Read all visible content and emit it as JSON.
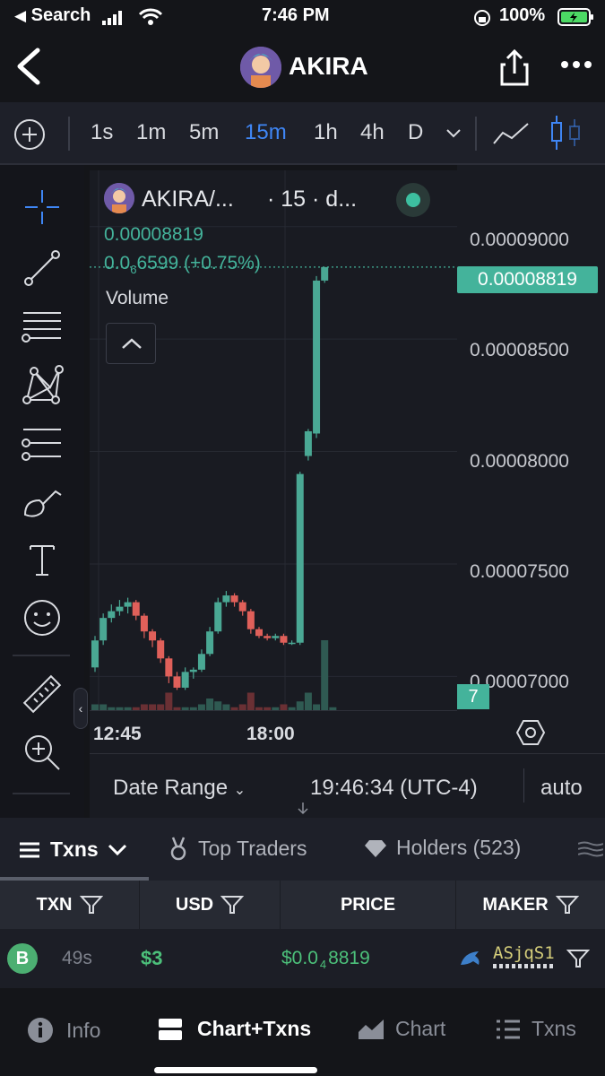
{
  "status": {
    "back_label": "Search",
    "time": "7:46 PM",
    "battery": "100%"
  },
  "nav": {
    "title": "AKIRA"
  },
  "toolbar": {
    "timeframes": [
      "1s",
      "1m",
      "5m",
      "15m",
      "1h",
      "4h",
      "D"
    ],
    "active_timeframe": "15m"
  },
  "legend": {
    "pair": "AKIRA/...",
    "interval": "· 15 · d...",
    "price": "0.00008819",
    "change_prefix": "0.0",
    "change_sub": "6",
    "change_rest": "6599 (+0.75%)",
    "volume_label": "Volume"
  },
  "yaxis": {
    "labels": [
      "0.00009000",
      "0.00008500",
      "0.00008000",
      "0.00007500",
      "0.00007000"
    ],
    "current_price": "0.00008819",
    "volume_badge": "7"
  },
  "xaxis": {
    "labels": [
      "12:45",
      "18:00"
    ]
  },
  "range": {
    "date_range": "Date Range",
    "clock": "19:46:34 (UTC-4)",
    "scale": "auto"
  },
  "tabs": {
    "txns": "Txns",
    "top_traders": "Top Traders",
    "holders": "Holders (523)"
  },
  "table": {
    "headers": [
      "TXN",
      "USD",
      "PRICE",
      "MAKER"
    ],
    "row": {
      "type": "B",
      "age": "49s",
      "usd": "$3",
      "price_prefix": "$0.0",
      "price_sub": "4",
      "price_rest": "8819",
      "maker": "ASjqS1"
    }
  },
  "bottom_nav": {
    "info": "Info",
    "chart_txns": "Chart+Txns",
    "chart": "Chart",
    "txns": "Txns"
  },
  "chart_data": {
    "type": "candlestick",
    "ylim": [
      6.85e-05,
      9.25e-05
    ],
    "candles": [
      {
        "o": 7.04e-05,
        "h": 7.18e-05,
        "l": 7.02e-05,
        "c": 7.16e-05
      },
      {
        "o": 7.16e-05,
        "h": 7.28e-05,
        "l": 7.14e-05,
        "c": 7.26e-05
      },
      {
        "o": 7.26e-05,
        "h": 7.32e-05,
        "l": 7.24e-05,
        "c": 7.29e-05
      },
      {
        "o": 7.29e-05,
        "h": 7.34e-05,
        "l": 7.27e-05,
        "c": 7.31e-05
      },
      {
        "o": 7.31e-05,
        "h": 7.35e-05,
        "l": 7.28e-05,
        "c": 7.33e-05
      },
      {
        "o": 7.33e-05,
        "h": 7.34e-05,
        "l": 7.25e-05,
        "c": 7.27e-05
      },
      {
        "o": 7.27e-05,
        "h": 7.28e-05,
        "l": 7.17e-05,
        "c": 7.2e-05
      },
      {
        "o": 7.2e-05,
        "h": 7.21e-05,
        "l": 7.13e-05,
        "c": 7.16e-05
      },
      {
        "o": 7.16e-05,
        "h": 7.17e-05,
        "l": 7.06e-05,
        "c": 7.08e-05
      },
      {
        "o": 7.08e-05,
        "h": 7.09e-05,
        "l": 6.97e-05,
        "c": 7e-05
      },
      {
        "o": 7e-05,
        "h": 7.02e-05,
        "l": 6.94e-05,
        "c": 6.95e-05
      },
      {
        "o": 6.95e-05,
        "h": 7.04e-05,
        "l": 6.94e-05,
        "c": 7.02e-05
      },
      {
        "o": 7.02e-05,
        "h": 7.04e-05,
        "l": 6.99e-05,
        "c": 7.03e-05
      },
      {
        "o": 7.03e-05,
        "h": 7.12e-05,
        "l": 7.02e-05,
        "c": 7.1e-05
      },
      {
        "o": 7.1e-05,
        "h": 7.22e-05,
        "l": 7.09e-05,
        "c": 7.2e-05
      },
      {
        "o": 7.2e-05,
        "h": 7.35e-05,
        "l": 7.19e-05,
        "c": 7.33e-05
      },
      {
        "o": 7.33e-05,
        "h": 7.38e-05,
        "l": 7.31e-05,
        "c": 7.36e-05
      },
      {
        "o": 7.36e-05,
        "h": 7.37e-05,
        "l": 7.31e-05,
        "c": 7.33e-05
      },
      {
        "o": 7.33e-05,
        "h": 7.34e-05,
        "l": 7.27e-05,
        "c": 7.29e-05
      },
      {
        "o": 7.29e-05,
        "h": 7.3e-05,
        "l": 7.19e-05,
        "c": 7.21e-05
      },
      {
        "o": 7.21e-05,
        "h": 7.22e-05,
        "l": 7.17e-05,
        "c": 7.18e-05
      },
      {
        "o": 7.18e-05,
        "h": 7.19e-05,
        "l": 7.16e-05,
        "c": 7.17e-05
      },
      {
        "o": 7.17e-05,
        "h": 7.19e-05,
        "l": 7.16e-05,
        "c": 7.18e-05
      },
      {
        "o": 7.18e-05,
        "h": 7.19e-05,
        "l": 7.14e-05,
        "c": 7.15e-05
      },
      {
        "o": 7.15e-05,
        "h": 7.16e-05,
        "l": 7.14e-05,
        "c": 7.15e-05
      },
      {
        "o": 7.15e-05,
        "h": 7.91e-05,
        "l": 7.14e-05,
        "c": 7.9e-05
      },
      {
        "o": 7.98e-05,
        "h": 8.1e-05,
        "l": 7.96e-05,
        "c": 8.09e-05
      },
      {
        "o": 8.08e-05,
        "h": 8.78e-05,
        "l": 8.06e-05,
        "c": 8.76e-05
      },
      {
        "o": 8.76e-05,
        "h": 8.82e-05,
        "l": 8.75e-05,
        "c": 8.82e-05
      }
    ],
    "volumes": [
      2,
      2,
      1,
      1,
      1,
      1,
      2,
      2,
      2,
      6,
      1,
      1,
      1,
      2,
      4,
      3,
      2,
      1,
      2,
      6,
      1,
      1,
      1,
      2,
      1,
      3,
      6,
      2,
      24,
      1
    ],
    "volume_max": 40,
    "xlabels": [
      "12:45",
      "18:00"
    ]
  }
}
